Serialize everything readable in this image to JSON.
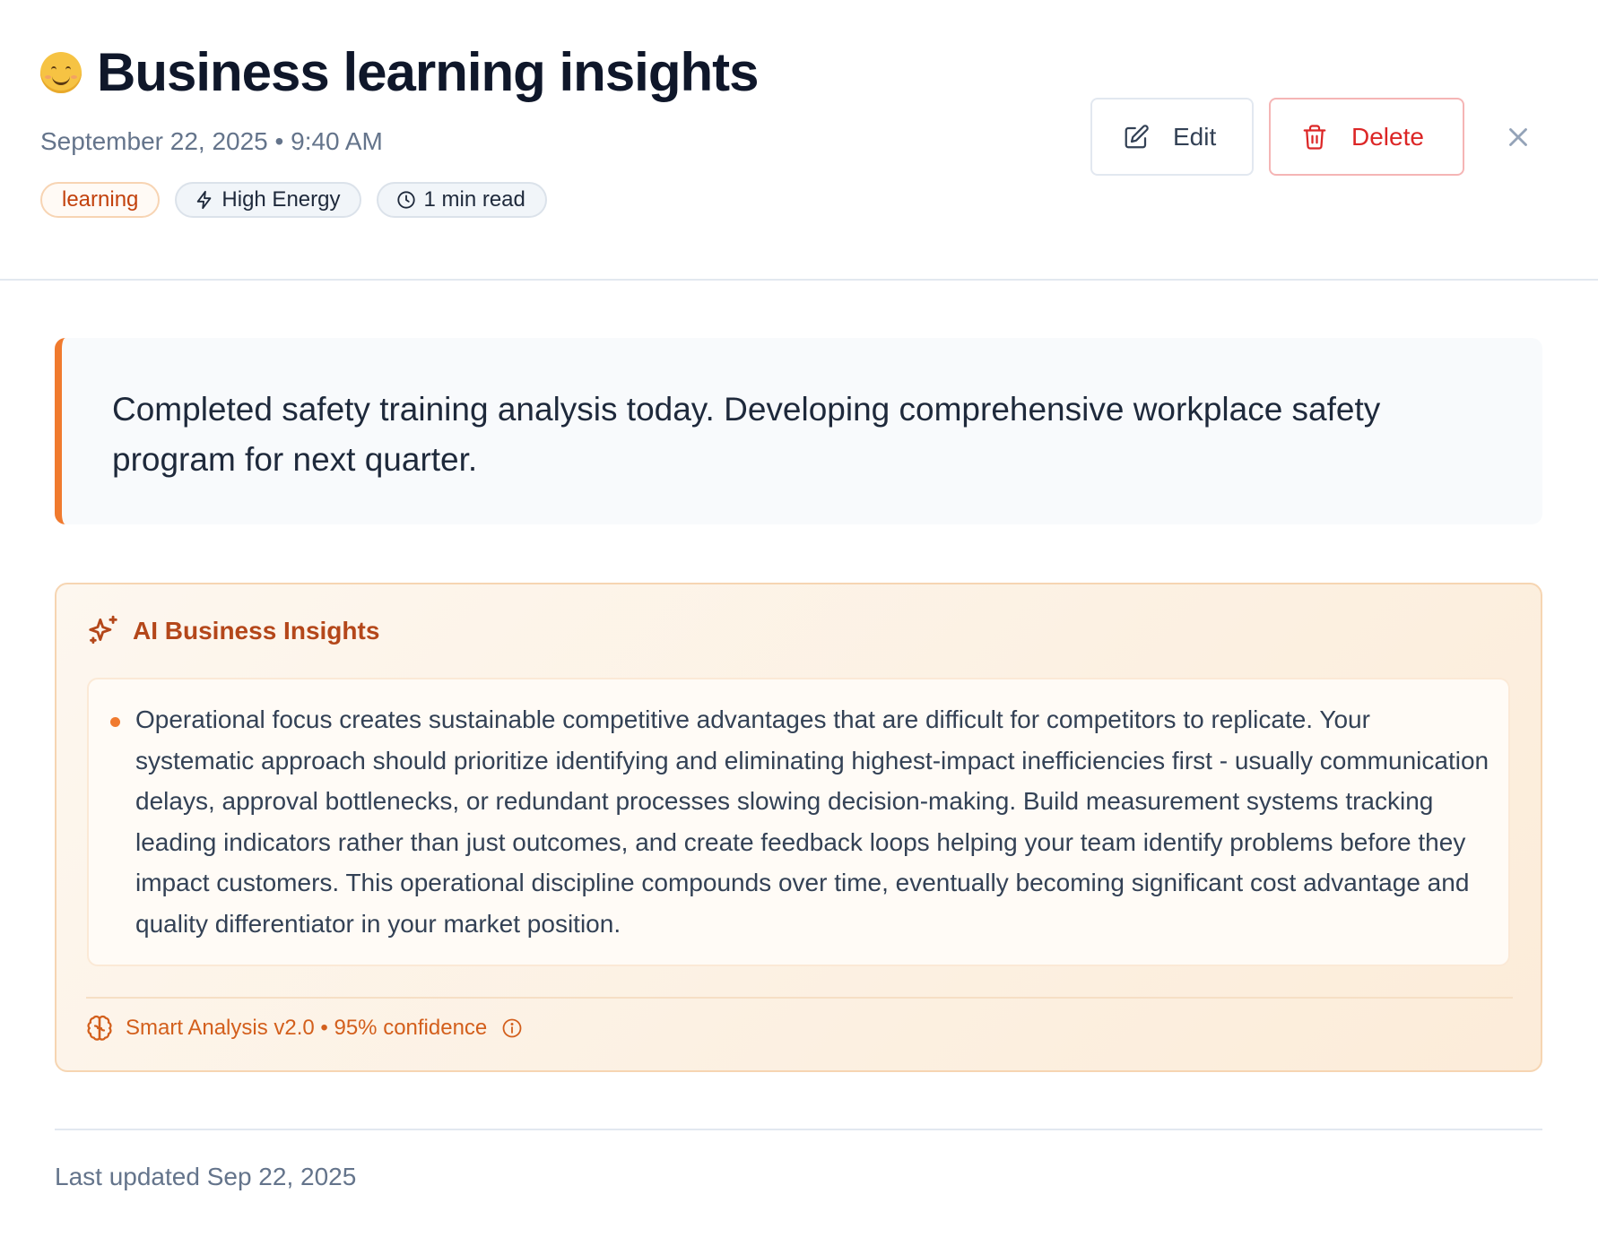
{
  "entry": {
    "title": "Business learning insights",
    "mood_icon": "smiling-face-emoji",
    "date": "September 22, 2025",
    "separator": "•",
    "time": "9:40 AM",
    "tags": {
      "category": "learning",
      "energy": "High Energy",
      "read_time": "1 min read"
    },
    "content": "Completed safety training analysis today. Developing comprehensive workplace safety program for next quarter."
  },
  "actions": {
    "edit_label": "Edit",
    "delete_label": "Delete"
  },
  "insights": {
    "title": "AI Business Insights",
    "items": [
      "Operational focus creates sustainable competitive advantages that are difficult for competitors to replicate. Your systematic approach should prioritize identifying and eliminating highest-impact inefficiencies first - usually communication delays, approval bottlenecks, or redundant processes slowing decision-making. Build measurement systems tracking leading indicators rather than just outcomes, and create feedback loops helping your team identify problems before they impact customers. This operational discipline compounds over time, eventually becoming significant cost advantage and quality differentiator in your market position."
    ],
    "footer": "Smart Analysis v2.0 • 95% confidence"
  },
  "footer": {
    "last_updated": "Last updated Sep 22, 2025"
  },
  "colors": {
    "accent": "#f07a2e",
    "delete": "#dc2626",
    "insight_title": "#b4471a"
  }
}
